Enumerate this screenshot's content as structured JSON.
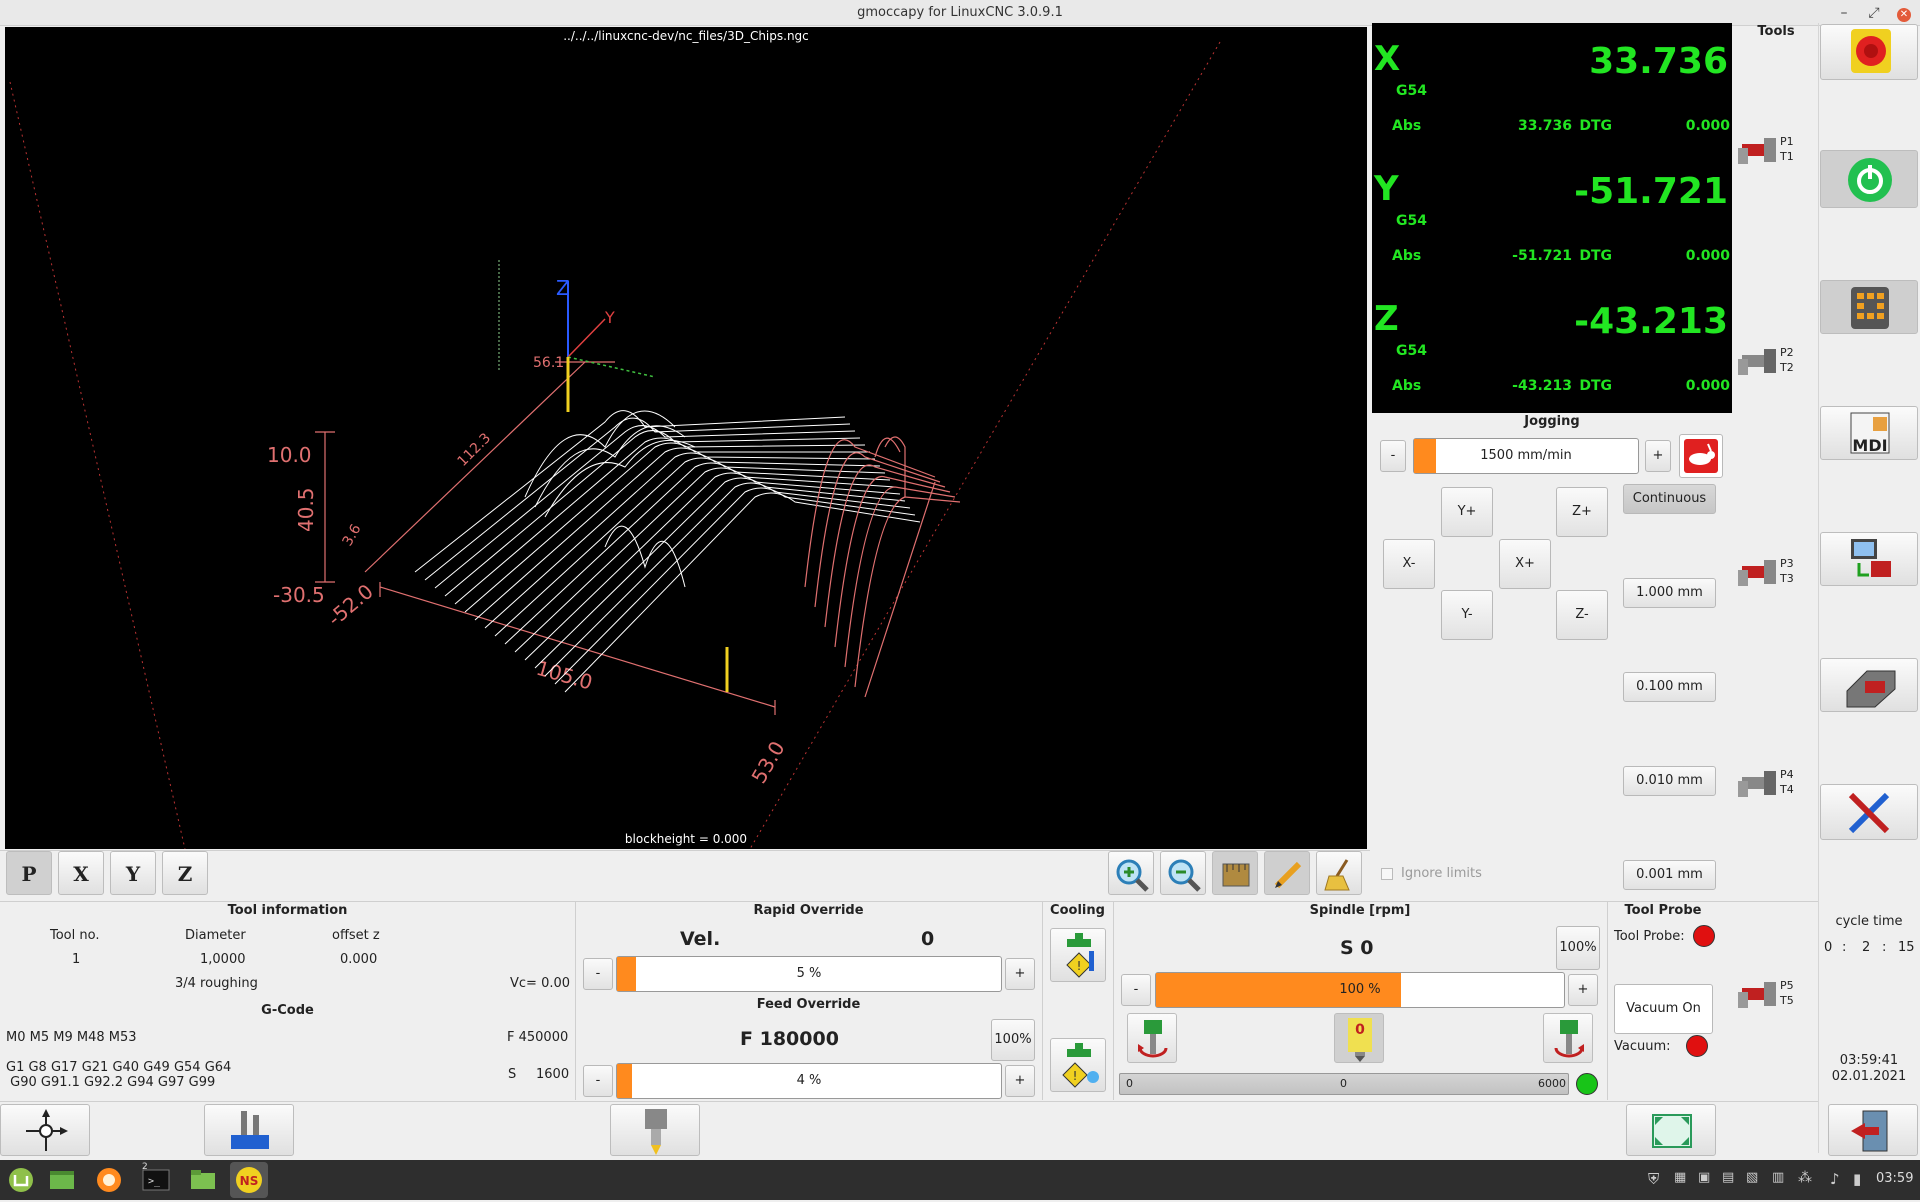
{
  "window": {
    "title": "gmoccapy for LinuxCNC  3.0.9.1"
  },
  "preview": {
    "file_path": "../../../linuxcnc-dev/nc_files/3D_Chips.ngc",
    "blockheight": "blockheight = 0.000",
    "labels": {
      "z_top": "10.0",
      "z_mid": "40.5",
      "z_bot": "-30.5",
      "x_min": "-52.0",
      "x_len": "105.0",
      "y_max": "53.0",
      "y_len": "112.3",
      "top_left": "56.1",
      "zz": "3.6",
      "axis_z": "Z",
      "axis_y": "Y"
    },
    "view_buttons": [
      "P",
      "X",
      "Y",
      "Z"
    ]
  },
  "dro": {
    "x": {
      "axis": "X",
      "value": "33.736",
      "offset": "G54",
      "abs_label": "Abs",
      "abs": "33.736",
      "dtg_label": "DTG",
      "dtg": "0.000"
    },
    "y": {
      "axis": "Y",
      "value": "-51.721",
      "offset": "G54",
      "abs_label": "Abs",
      "abs": "-51.721",
      "dtg_label": "DTG",
      "dtg": "0.000"
    },
    "z": {
      "axis": "Z",
      "value": "-43.213",
      "offset": "G54",
      "abs_label": "Abs",
      "abs": "-43.213",
      "dtg_label": "DTG",
      "dtg": "0.000"
    }
  },
  "jogging": {
    "title": "Jogging",
    "minus": "-",
    "plus": "+",
    "speed": "1500 mm/min",
    "speed_fraction": 0.1,
    "buttons": {
      "yplus": "Y+",
      "zplus": "Z+",
      "xminus": "X-",
      "xplus": "X+",
      "yminus": "Y-",
      "zminus": "Z-"
    },
    "increments": [
      "Continuous",
      "1.000 mm",
      "0.100 mm",
      "0.010 mm",
      "0.001 mm"
    ],
    "ignore_limits": "Ignore limits"
  },
  "tools_panel": {
    "title": "Tools",
    "pockets": [
      {
        "p": "P1",
        "t": "T1"
      },
      {
        "p": "P2",
        "t": "T2"
      },
      {
        "p": "P3",
        "t": "T3"
      },
      {
        "p": "P4",
        "t": "T4"
      },
      {
        "p": "P5",
        "t": "T5"
      }
    ],
    "mdi_label": "MDI"
  },
  "cycle": {
    "title": "cycle time",
    "h": "0",
    "sep1": ":",
    "m": "2",
    "sep2": ":",
    "s": "15"
  },
  "clock": {
    "time": "03:59:41",
    "date": "02.01.2021"
  },
  "tool_info": {
    "title": "Tool information",
    "headers": [
      "Tool no.",
      "Diameter",
      "offset z"
    ],
    "values": [
      "1",
      "1,0000",
      "0.000"
    ],
    "description": "3/4 roughing",
    "vc": "Vc= 0.00"
  },
  "gcode": {
    "title": "G-Code",
    "mcodes": "M0 M5 M9 M48 M53",
    "feed": "F 450000",
    "gcodes1": "G1 G8 G17 G21 G40 G49 G54 G64",
    "gcodes2": " G90 G91.1 G92.2 G94 G97 G99",
    "speed_label": "S",
    "speed_value": "1600"
  },
  "rapid": {
    "title": "Rapid Override",
    "vel_label": "Vel.",
    "vel_value": "0",
    "minus": "-",
    "plus": "+",
    "percent": "5 %",
    "fraction": 0.05
  },
  "feed": {
    "title": "Feed Override",
    "value": "F  180000",
    "reset": "100%",
    "minus": "-",
    "plus": "+",
    "percent": "4 %",
    "fraction": 0.04
  },
  "cooling": {
    "title": "Cooling"
  },
  "spindle": {
    "title": "Spindle [rpm]",
    "s_value": "S 0",
    "reset": "100%",
    "minus": "-",
    "plus": "+",
    "percent": "100 %",
    "fraction": 0.6,
    "scale_min": "0",
    "scale_mid": "0",
    "scale_max": "6000",
    "stop_label": "0"
  },
  "probe": {
    "title": "Tool Probe",
    "probe_label": "Tool Probe:",
    "vacuum_btn": "Vacuum On",
    "vacuum_label": "Vacuum:"
  },
  "colors": {
    "dro_green": "#22e622",
    "accent_orange": "#ff8a1e",
    "led_red": "#e01010",
    "led_green": "#18c418",
    "path_white": "#ffffff",
    "path_red": "#e07070"
  },
  "taskbar": {
    "time": "03:59",
    "terminal_badge": "2"
  }
}
